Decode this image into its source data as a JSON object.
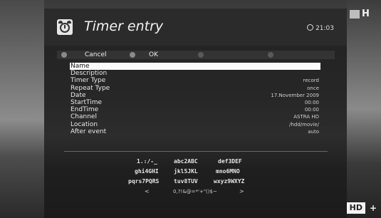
{
  "header": {
    "title": "Timer entry",
    "time": "21:03"
  },
  "buttons": {
    "cancel": "Cancel",
    "ok": "OK"
  },
  "form": {
    "rows": [
      {
        "label": "Name",
        "value": ""
      },
      {
        "label": "Description",
        "value": ""
      },
      {
        "label": "Timer Type",
        "value": "record"
      },
      {
        "label": "Repeat Type",
        "value": "once"
      },
      {
        "label": "Date",
        "value": "17.November 2009"
      },
      {
        "label": "StartTime",
        "value": "00:00"
      },
      {
        "label": "EndTime",
        "value": "00:00"
      },
      {
        "label": "Channel",
        "value": "ASTRA HD"
      },
      {
        "label": "Location",
        "value": "/hdd/movie/"
      },
      {
        "label": "After event",
        "value": "auto"
      }
    ]
  },
  "keyboard": {
    "row1": [
      "1.:/-_",
      "abc2ABC",
      "def3DEF"
    ],
    "row2": [
      "ghi4GHI",
      "jkl5JKL",
      "mno6MNO"
    ],
    "row3": [
      "pqrs7PQRS",
      "tuv8TUV",
      "wxyz9WXYZ"
    ],
    "row4": [
      "<",
      "0,?!&@=*'+\"()$~",
      ">"
    ]
  },
  "corner": {
    "logo": "H",
    "hd": "HD",
    "plus": "+"
  },
  "colors": {
    "panel": "#1c1c1c",
    "highlight": "#fafafa"
  }
}
